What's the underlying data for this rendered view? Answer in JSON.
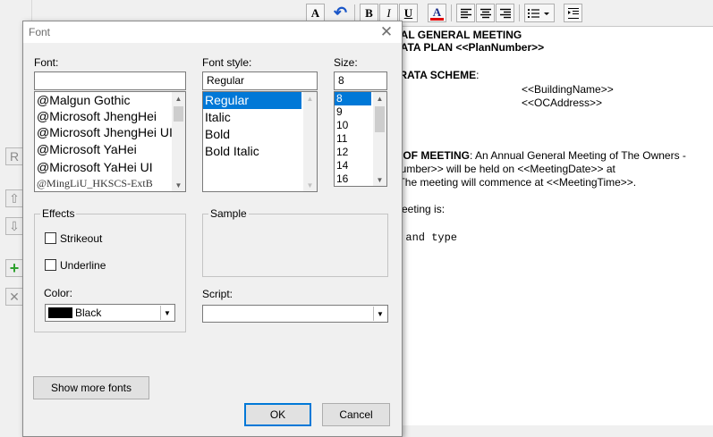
{
  "app": {
    "side_buttons": [
      {
        "name": "R-button",
        "glyph": "R"
      },
      {
        "name": "move-up-icon",
        "glyph": "⇧"
      },
      {
        "name": "move-down-icon",
        "glyph": "⇩"
      },
      {
        "name": "add-icon",
        "glyph": "+"
      },
      {
        "name": "delete-icon",
        "glyph": "✕"
      }
    ],
    "toolbar": {
      "font_button_glyph": "A",
      "undo_glyph": "↶",
      "bold_glyph": "B",
      "italic_glyph": "I",
      "underline_glyph": "U",
      "font_color_glyph": "A",
      "font_color_accent": "#e00000"
    },
    "document": {
      "lines": [
        {
          "text": "UAL GENERAL MEETING",
          "bold": true
        },
        {
          "text": "RATA PLAN <<PlanNumber>>",
          "bold": true
        },
        {
          "text": "TRATA SCHEME",
          "bold": true,
          "suffix": ":"
        },
        {
          "text": "<<BuildingName>>"
        },
        {
          "text": "<<OCAddress>>"
        },
        {
          "text": "E OF MEETING",
          "bold": true,
          "suffix": ": An Annual General Meeting of The Owners -"
        },
        {
          "text": "Number>> will be held on <<MeetingDate>> at"
        },
        {
          "text": ". The meeting will commence at <<MeetingTime>>."
        },
        {
          "text": "meeting is:"
        },
        {
          "text": "e and type",
          "mono": true
        }
      ]
    }
  },
  "dialog": {
    "title": "Font",
    "close_glyph": "✕",
    "font_label": "Font:",
    "font_value": "",
    "font_list": [
      "@Malgun Gothic",
      "@Microsoft JhengHei",
      "@Microsoft JhengHei UI",
      "@Microsoft YaHei",
      "@Microsoft YaHei UI",
      "@MingLiU_HKSCS-ExtB"
    ],
    "style_label": "Font style:",
    "style_value": "Regular",
    "style_list": [
      "Regular",
      "Italic",
      "Bold",
      "Bold Italic"
    ],
    "style_selected": 0,
    "size_label": "Size:",
    "size_value": "8",
    "size_list": [
      "8",
      "9",
      "10",
      "11",
      "12",
      "14",
      "16"
    ],
    "size_selected": 0,
    "effects_label": "Effects",
    "strikeout_label": "Strikeout",
    "underline_label": "Underline",
    "strikeout_checked": false,
    "underline_checked": false,
    "color_label": "Color:",
    "color_value": "Black",
    "color_swatch": "#000000",
    "sample_label": "Sample",
    "script_label": "Script:",
    "script_value": "",
    "show_more_label": "Show more fonts",
    "ok_label": "OK",
    "cancel_label": "Cancel"
  }
}
